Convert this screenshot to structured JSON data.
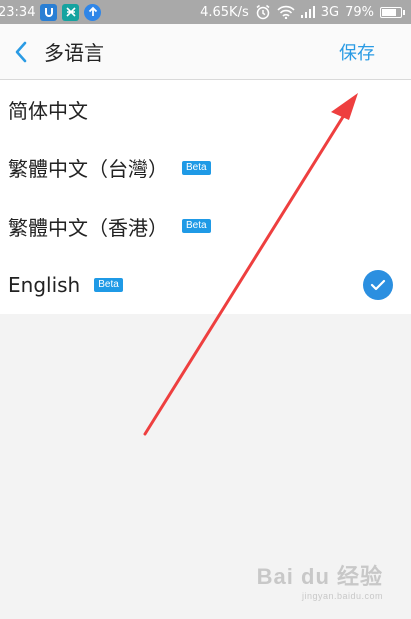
{
  "status_bar": {
    "time": "23:34",
    "speed": "4.65K/s",
    "network": "3G",
    "battery": "79%"
  },
  "header": {
    "title": "多语言",
    "save_label": "保存"
  },
  "languages": [
    {
      "label": "简体中文",
      "beta": "",
      "selected": false
    },
    {
      "label": "繁體中文（台灣）",
      "beta": "Beta",
      "selected": false
    },
    {
      "label": "繁體中文（香港）",
      "beta": "Beta",
      "selected": false
    },
    {
      "label": "English",
      "beta": "Beta",
      "selected": true
    }
  ],
  "watermark": {
    "main": "Bai du 经验",
    "sub": "jingyan.baidu.com"
  },
  "colors": {
    "accent": "#2a9be4",
    "beta_badge": "#1f9ae6",
    "check": "#2b8fe0",
    "arrow": "#ee3f3f"
  }
}
